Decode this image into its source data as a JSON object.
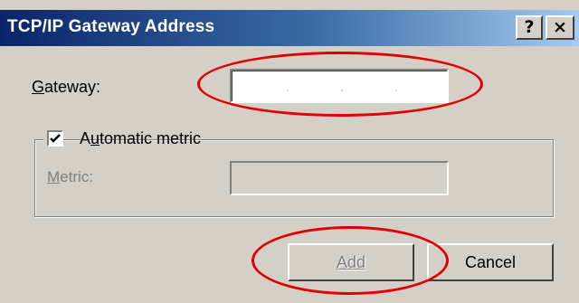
{
  "window": {
    "title": "TCP/IP Gateway Address",
    "help_label": "?",
    "close_label": "×"
  },
  "gateway": {
    "label_accel": "G",
    "label_rest": "ateway:",
    "ip_separators": [
      ".",
      ".",
      "."
    ]
  },
  "metric_group": {
    "checkbox_checked": true,
    "label_pre": "A",
    "label_accel": "u",
    "label_rest": "tomatic metric",
    "metric_label_accel": "M",
    "metric_label_rest": "etric:",
    "metric_value": ""
  },
  "buttons": {
    "add_accel": "A",
    "add_rest": "dd",
    "add_enabled": false,
    "cancel_label": "Cancel"
  },
  "annotations": {
    "highlight_color": "#e00000"
  }
}
